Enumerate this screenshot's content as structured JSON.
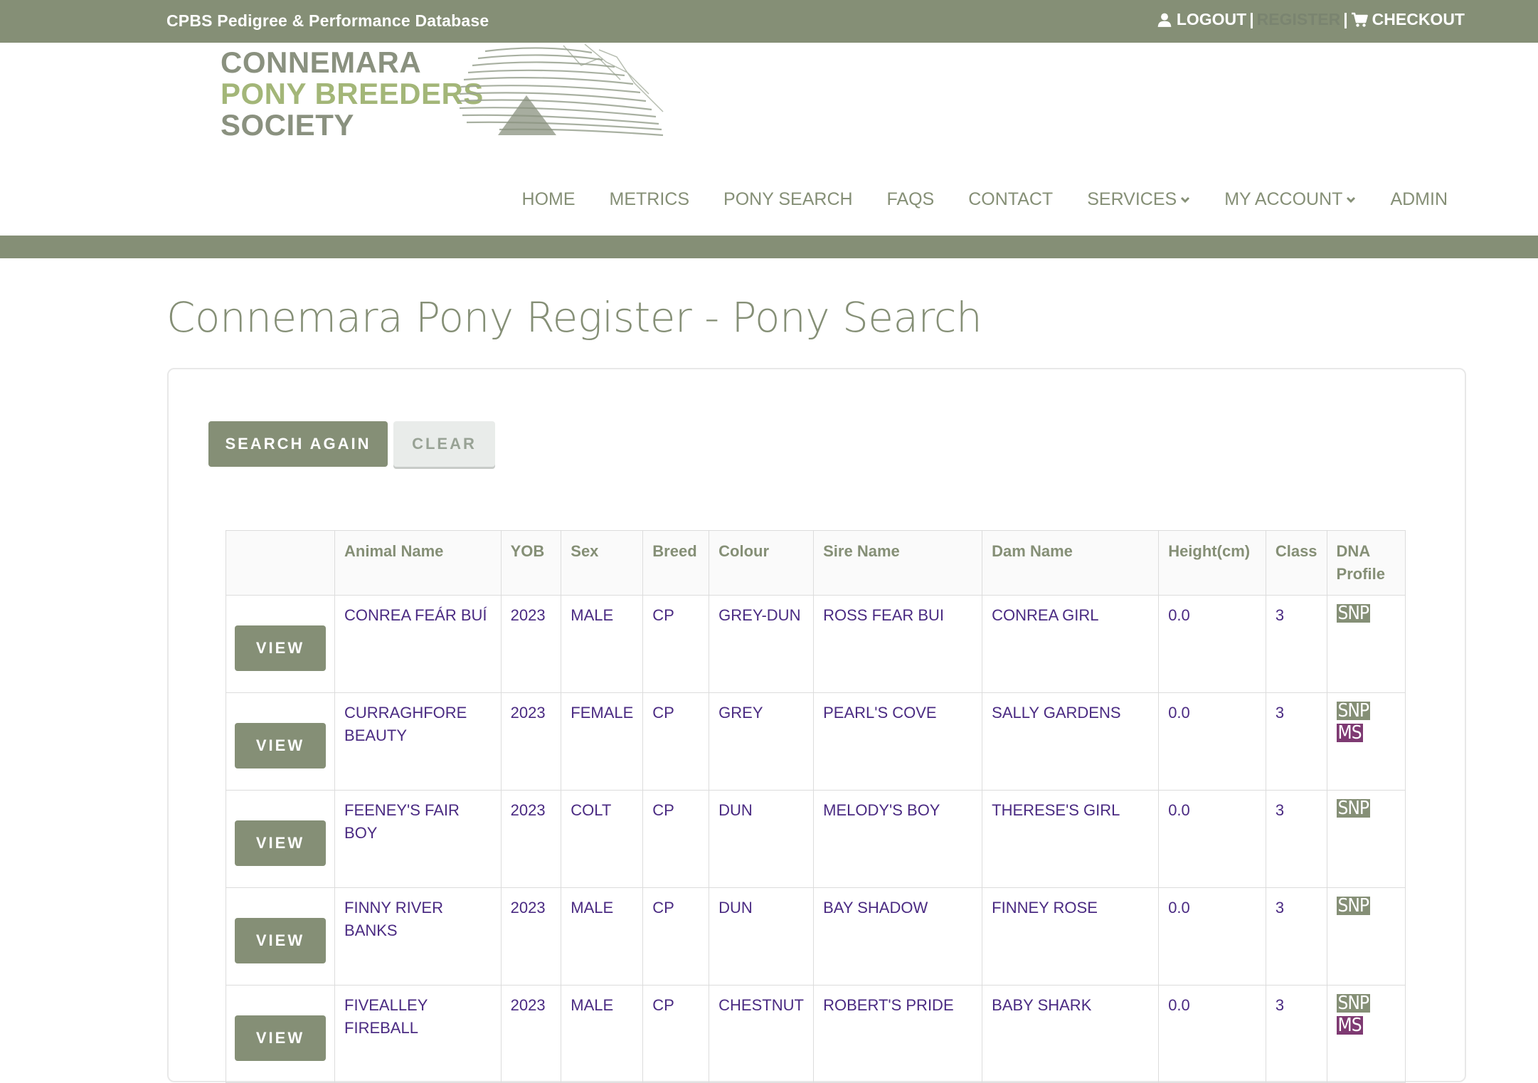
{
  "topbar": {
    "title": "CPBS Pedigree & Performance Database",
    "logout": "LOGOUT",
    "register": "REGISTER",
    "checkout": "CHECKOUT",
    "separator": "|"
  },
  "logo": {
    "line1": "CONNEMARA",
    "line2": "PONY BREEDERS",
    "line3": "SOCIETY"
  },
  "nav": {
    "home": "HOME",
    "metrics": "METRICS",
    "pony_search": "PONY SEARCH",
    "faqs": "FAQS",
    "contact": "CONTACT",
    "services": "SERVICES",
    "my_account": "MY ACCOUNT",
    "admin": "ADMIN"
  },
  "page": {
    "title": "Connemara Pony Register - Pony Search"
  },
  "actions": {
    "search_again": "SEARCH AGAIN",
    "clear": "CLEAR",
    "view": "VIEW"
  },
  "table": {
    "headers": [
      "",
      "Animal Name",
      "YOB",
      "Sex",
      "Breed",
      "Colour",
      "Sire Name",
      "Dam Name",
      "Height(cm)",
      "Class",
      "DNA Profile"
    ],
    "rows": [
      {
        "name": "CONREA FEÁR BUÍ",
        "yob": "2023",
        "sex": "MALE",
        "breed": "CP",
        "colour": "GREY-DUN",
        "sire": "ROSS FEAR BUI",
        "dam": "CONREA GIRL",
        "height": "0.0",
        "class": "3",
        "dna": [
          "SNP"
        ]
      },
      {
        "name": "CURRAGHFORE BEAUTY",
        "yob": "2023",
        "sex": "FEMALE",
        "breed": "CP",
        "colour": "GREY",
        "sire": "PEARL'S COVE",
        "dam": "SALLY GARDENS",
        "height": "0.0",
        "class": "3",
        "dna": [
          "SNP",
          "MS"
        ]
      },
      {
        "name": "FEENEY'S FAIR BOY",
        "yob": "2023",
        "sex": "COLT",
        "breed": "CP",
        "colour": "DUN",
        "sire": "MELODY'S BOY",
        "dam": "THERESE'S GIRL",
        "height": "0.0",
        "class": "3",
        "dna": [
          "SNP"
        ]
      },
      {
        "name": "FINNY RIVER BANKS",
        "yob": "2023",
        "sex": "MALE",
        "breed": "CP",
        "colour": "DUN",
        "sire": "BAY SHADOW",
        "dam": "FINNEY ROSE",
        "height": "0.0",
        "class": "3",
        "dna": [
          "SNP"
        ]
      },
      {
        "name": "FIVEALLEY FIREBALL",
        "yob": "2023",
        "sex": "MALE",
        "breed": "CP",
        "colour": "CHESTNUT",
        "sire": "ROBERT'S PRIDE",
        "dam": "BABY SHARK",
        "height": "0.0",
        "class": "3",
        "dna": [
          "SNP",
          "MS"
        ]
      }
    ]
  },
  "colors": {
    "brand_green": "#858f76",
    "logo_light_green": "#a3b678",
    "link_purple": "#4a2a82",
    "ms_badge": "#7e3a72"
  }
}
